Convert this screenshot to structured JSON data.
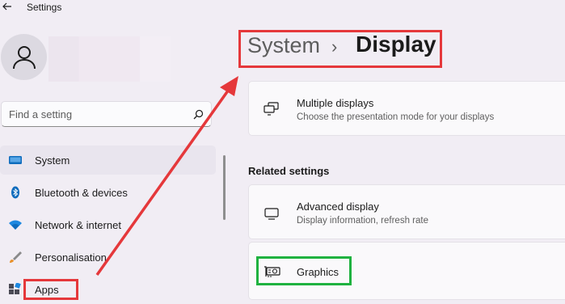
{
  "window": {
    "title": "Settings"
  },
  "account": {},
  "search": {
    "placeholder": "Find a setting"
  },
  "nav": {
    "items": [
      {
        "label": "System",
        "icon": "system-monitor-icon",
        "selected": true
      },
      {
        "label": "Bluetooth & devices",
        "icon": "bluetooth-icon"
      },
      {
        "label": "Network & internet",
        "icon": "wifi-icon"
      },
      {
        "label": "Personalisation",
        "icon": "brush-icon"
      },
      {
        "label": "Apps",
        "icon": "apps-icon"
      }
    ]
  },
  "header": {
    "parent": "System",
    "separator": "›",
    "current": "Display"
  },
  "cards": {
    "multiple_displays": {
      "title": "Multiple displays",
      "subtitle": "Choose the presentation mode for your displays",
      "icon": "multiple-displays-icon"
    },
    "related_heading": "Related settings",
    "advanced_display": {
      "title": "Advanced display",
      "subtitle": "Display information, refresh rate",
      "icon": "monitor-icon"
    },
    "graphics": {
      "title": "Graphics",
      "icon": "graphics-card-icon"
    }
  },
  "annotations": {
    "red": "#e5383b",
    "green": "#1fb240"
  }
}
